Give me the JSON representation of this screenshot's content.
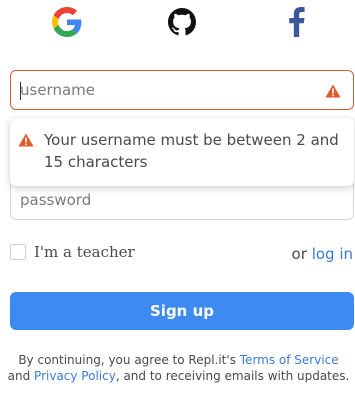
{
  "social": {
    "google_letter": "G",
    "facebook_letter": "f"
  },
  "username": {
    "placeholder": "username",
    "value": ""
  },
  "error": {
    "message": "Your username must be between 2 and 15 characters"
  },
  "password": {
    "placeholder": "password",
    "value": ""
  },
  "teacher": {
    "label": "I'm a teacher",
    "checked": false
  },
  "login": {
    "prefix": "or",
    "link": "log in"
  },
  "signup": {
    "label": "Sign up"
  },
  "terms": {
    "part1": "By continuing, you agree to Repl.it's ",
    "link1": "Terms of Service",
    "part2": " and ",
    "link2": "Privacy Policy",
    "part3": ", and to receiving emails with updates."
  },
  "colors": {
    "accent": "#3d8af0",
    "link": "#3a7bd5",
    "error": "#e05a2b"
  }
}
